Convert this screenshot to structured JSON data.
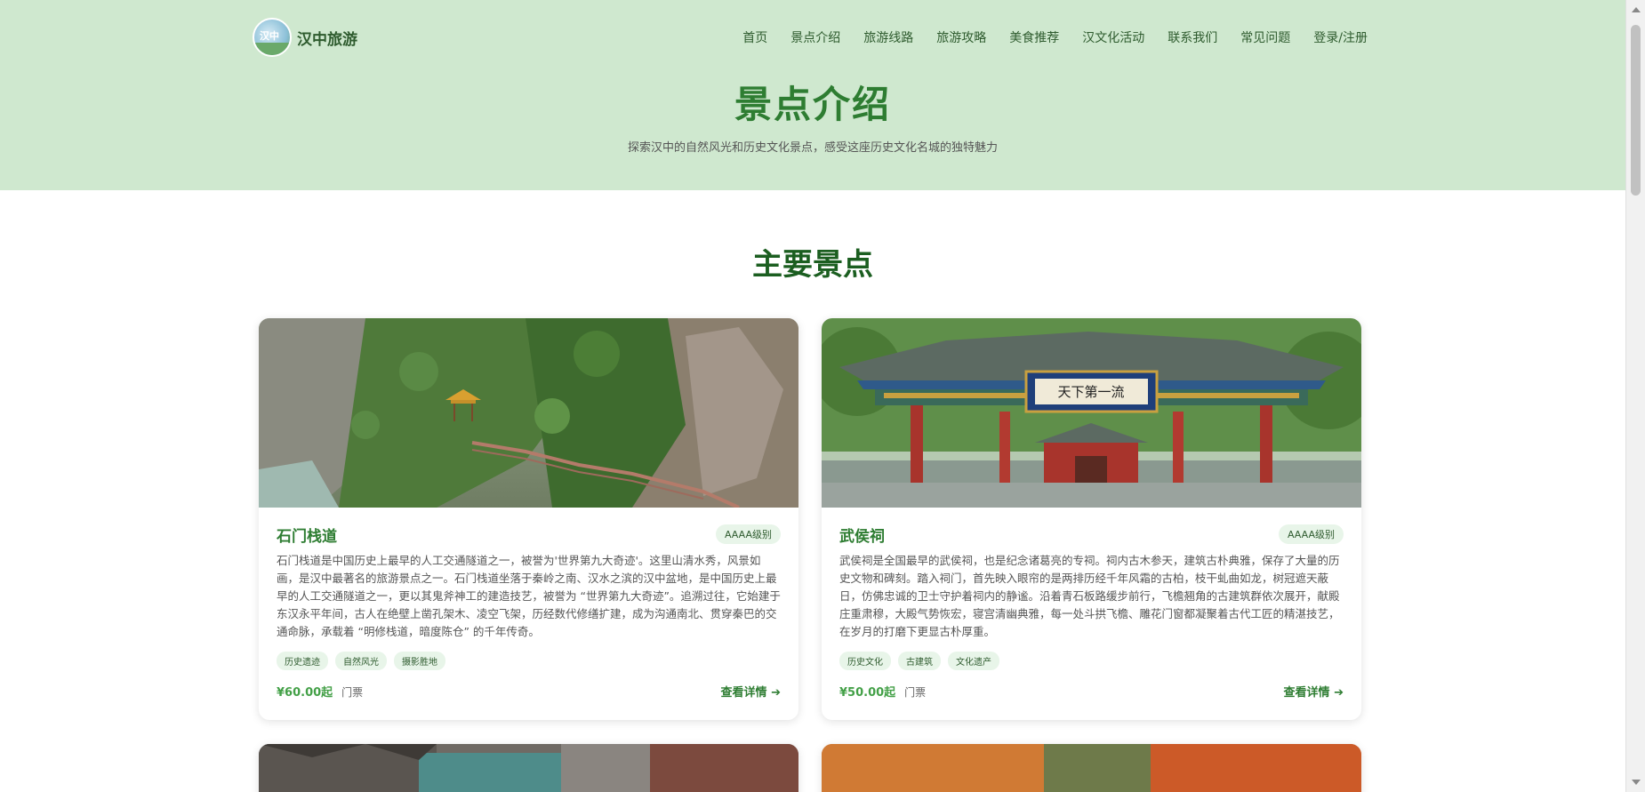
{
  "brand": {
    "logo_text": "汉中",
    "name": "汉中旅游"
  },
  "nav": [
    {
      "label": "首页"
    },
    {
      "label": "景点介绍"
    },
    {
      "label": "旅游线路"
    },
    {
      "label": "旅游攻略"
    },
    {
      "label": "美食推荐"
    },
    {
      "label": "汉文化活动"
    },
    {
      "label": "联系我们"
    },
    {
      "label": "常见问题"
    },
    {
      "label": "登录/注册"
    }
  ],
  "hero": {
    "title": "景点介绍",
    "subtitle": "探索汉中的自然风光和历史文化景点，感受这座历史文化名城的独特魅力"
  },
  "section_title": "主要景点",
  "cards": [
    {
      "name": "石门栈道",
      "level": "AAAA级别",
      "desc": "石门栈道是中国历史上最早的人工交通隧道之一，被誉为'世界第九大奇迹'。这里山清水秀，风景如画，是汉中最著名的旅游景点之一。石门栈道坐落于秦岭之南、汉水之滨的汉中盆地，是中国历史上最早的人工交通隧道之一，更以其鬼斧神工的建造技艺，被誉为 “世界第九大奇迹”。追溯过往，它始建于东汉永平年间，古人在绝壁上凿孔架木、凌空飞架，历经数代修缮扩建，成为沟通南北、贯穿秦巴的交通命脉，承载着 “明修栈道，暗度陈仓” 的千年传奇。",
      "tags": [
        "历史遗迹",
        "自然风光",
        "摄影胜地"
      ],
      "price": "¥60.00起",
      "price_note": "门票",
      "more": "查看详情"
    },
    {
      "name": "武侯祠",
      "level": "AAAA级别",
      "desc": "武侯祠是全国最早的武侯祠，也是纪念诸葛亮的专祠。祠内古木参天，建筑古朴典雅，保存了大量的历史文物和碑刻。踏入祠门，首先映入眼帘的是两排历经千年风霜的古柏，枝干虬曲如龙，树冠遮天蔽日，仿佛忠诚的卫士守护着祠内的静谧。沿着青石板路缓步前行，飞檐翘角的古建筑群依次展开，献殿庄重肃穆，大殿气势恢宏，寝宫清幽典雅，每一处斗拱飞檐、雕花门窗都凝聚着古代工匠的精湛技艺，在岁月的打磨下更显古朴厚重。",
      "tags": [
        "历史文化",
        "古建筑",
        "文化遗产"
      ],
      "price": "¥50.00起",
      "price_note": "门票",
      "more": "查看详情"
    }
  ],
  "gate_plaque": "天下第一流"
}
